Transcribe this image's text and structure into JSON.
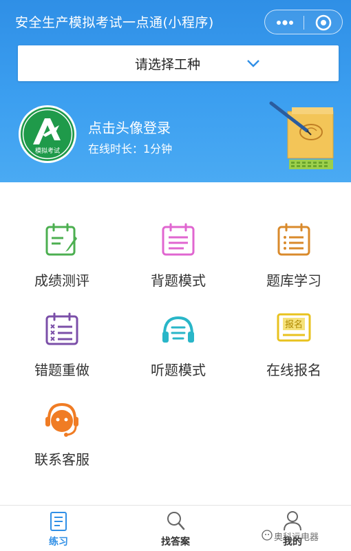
{
  "header": {
    "title": "安全生产模拟考试一点通(小程序)",
    "select_placeholder": "请选择工种",
    "login_prompt": "点击头像登录",
    "online_time": "在线时长：1分钟",
    "avatar_text": "模拟考试",
    "bg_color": "#2f8fe6"
  },
  "menu": [
    {
      "label": "成绩测评",
      "icon": "score-evaluation-icon",
      "color": "#4caf50"
    },
    {
      "label": "背题模式",
      "icon": "memorize-mode-icon",
      "color": "#e066d0"
    },
    {
      "label": "题库学习",
      "icon": "question-bank-icon",
      "color": "#d98a2b"
    },
    {
      "label": "错题重做",
      "icon": "wrong-redo-icon",
      "color": "#7b4fa8"
    },
    {
      "label": "听题模式",
      "icon": "headphones-icon",
      "color": "#29b6c8"
    },
    {
      "label": "在线报名",
      "icon": "online-signup-icon",
      "color": "#e8c21e",
      "icon_text": "报名"
    },
    {
      "label": "联系客服",
      "icon": "customer-service-icon",
      "color": "#f07c24"
    }
  ],
  "tabbar": {
    "items": [
      {
        "label": "练习",
        "icon": "practice-icon",
        "active": true
      },
      {
        "label": "找答案",
        "icon": "search-icon",
        "active": false
      },
      {
        "label": "我的",
        "icon": "profile-icon",
        "active": false
      }
    ]
  },
  "watermark": "奥科远电器"
}
